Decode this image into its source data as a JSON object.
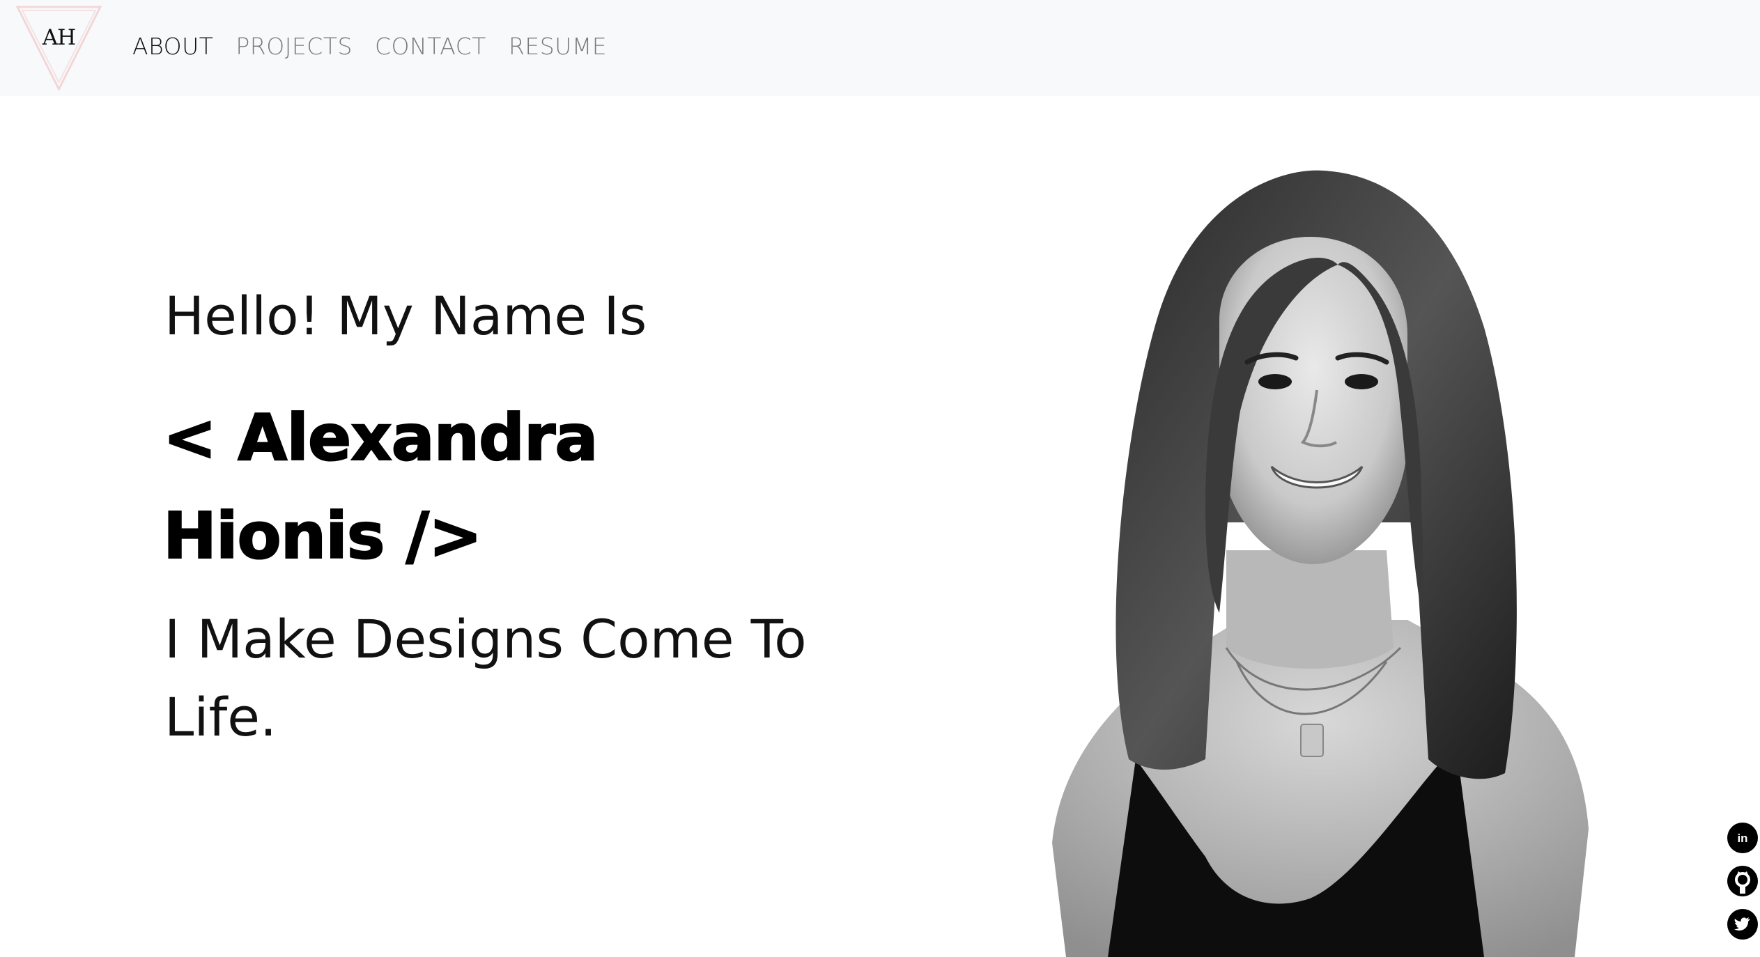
{
  "nav": {
    "logo_text": "AH",
    "items": [
      {
        "label": "ABOUT",
        "active": true
      },
      {
        "label": "PROJECTS",
        "active": false
      },
      {
        "label": "CONTACT",
        "active": false
      },
      {
        "label": "RESUME",
        "active": false
      }
    ]
  },
  "hero": {
    "greeting": "Hello! My Name Is",
    "name_line1": "< Alexandra",
    "name_line2": "Hionis />",
    "tagline_line1": "I Make Designs Come To",
    "tagline_line2": "Life."
  },
  "portrait": {
    "icon": "portrait-photo"
  },
  "social": [
    {
      "icon": "linkedin-icon",
      "label": "in"
    },
    {
      "icon": "github-icon"
    },
    {
      "icon": "twitter-icon"
    }
  ],
  "colors": {
    "nav_bg": "#f8f9fa",
    "nav_active": "#111111",
    "nav_inactive": "#7a7a7a",
    "text": "#000000",
    "logo_triangle": "#f2d7d9"
  }
}
